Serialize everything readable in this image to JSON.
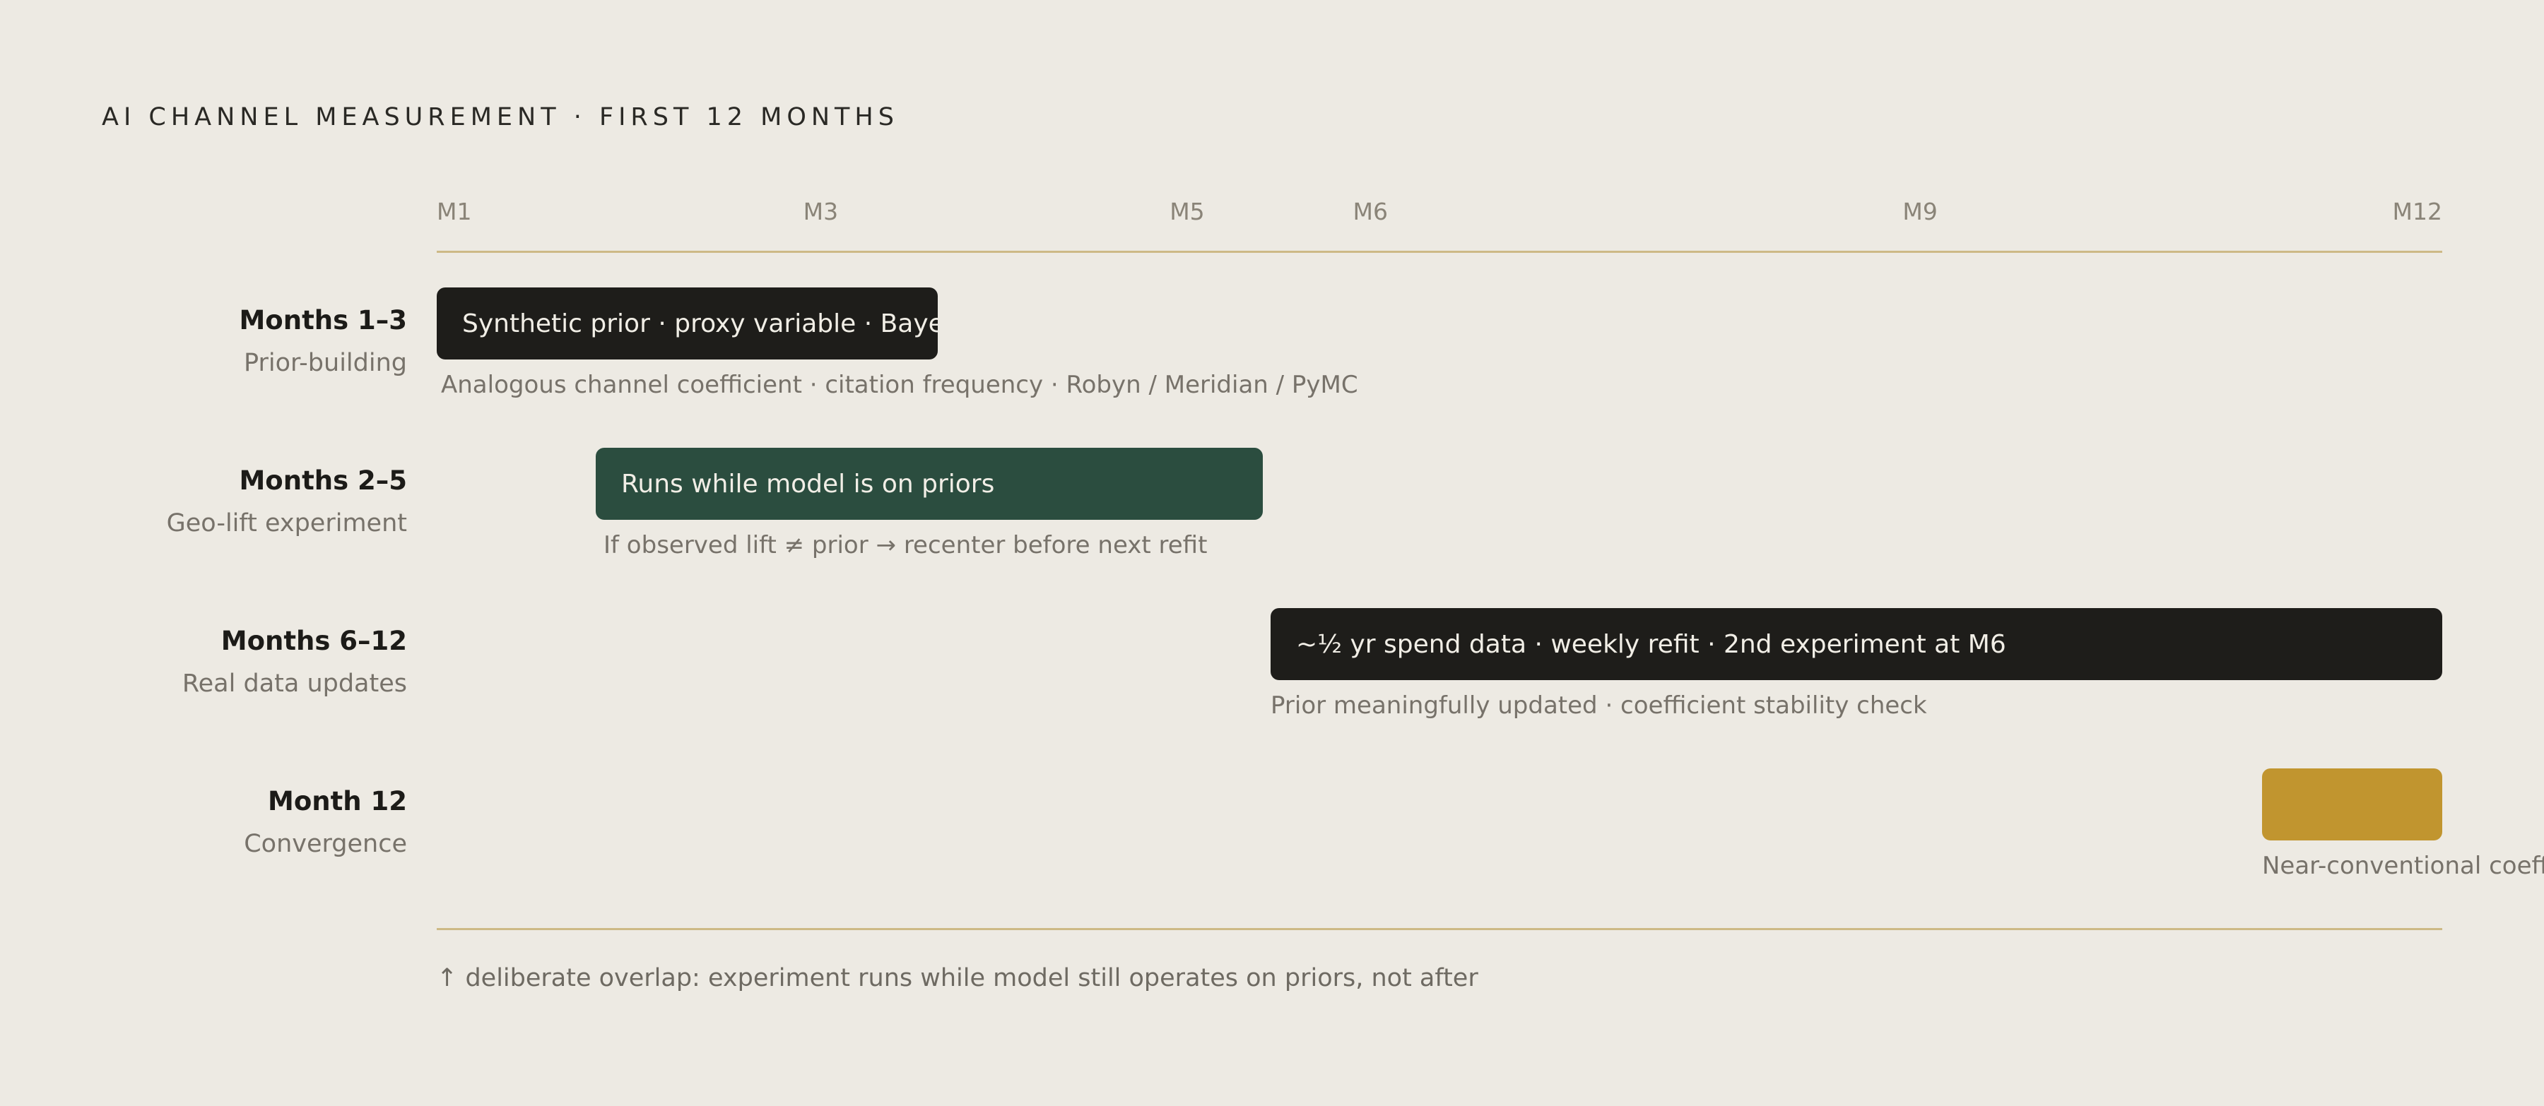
{
  "header": {
    "title": "AI CHANNEL MEASUREMENT · FIRST 12 MONTHS"
  },
  "colors": {
    "background": "#edeae3",
    "rule": "#cdb986",
    "dark_bar": "#1e1d1a",
    "green_bar": "#2b4d3f",
    "gold_bar": "#c1952f"
  },
  "chart_data": {
    "type": "gantt",
    "x_ticks": [
      "M1",
      "M3",
      "M5",
      "M6",
      "M9",
      "M12"
    ],
    "rows": [
      {
        "phase": "Months 1–3",
        "subtitle": "Prior-building",
        "bar_text": "Synthetic prior · proxy variable · Bayesian",
        "note": "Analogous channel coefficient · citation frequency · Robyn / Meridian / PyMC",
        "start": 1,
        "end": 3,
        "color": "#1e1d1a"
      },
      {
        "phase": "Months 2–5",
        "subtitle": "Geo-lift experiment",
        "bar_text": "Runs while model is on priors",
        "note": "If observed lift ≠ prior → recenter before next refit",
        "start": 2,
        "end": 5,
        "color": "#2b4d3f"
      },
      {
        "phase": "Months 6–12",
        "subtitle": "Real data updates",
        "bar_text": "~½ yr spend data · weekly refit · 2nd experiment at M6",
        "note": "Prior meaningfully updated · coefficient stability check",
        "start": 6,
        "end": 12,
        "color": "#1e1d1a"
      },
      {
        "phase": "Month 12",
        "subtitle": "Convergence",
        "bar_text": "",
        "note": "Near-conventional coeff",
        "start": 11,
        "end": 12,
        "color": "#c1952f"
      }
    ],
    "footnote": "↑ deliberate overlap: experiment runs while model still operates on priors, not after"
  }
}
